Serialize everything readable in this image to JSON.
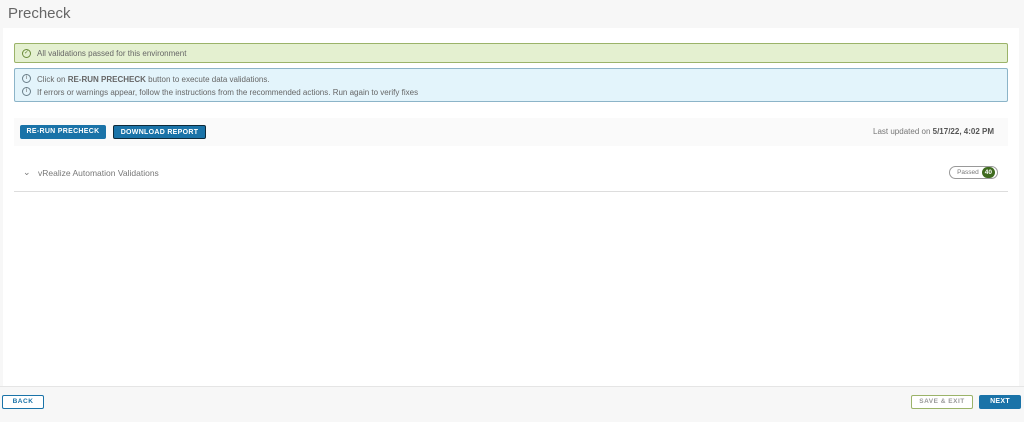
{
  "title": "Precheck",
  "alerts": {
    "success": "All validations passed for this environment",
    "info1_pre": "Click on ",
    "info1_bold": "RE-RUN PRECHECK",
    "info1_post": " button to execute data validations.",
    "info2": "If errors or warnings appear, follow the instructions from the recommended actions. Run again to verify fixes"
  },
  "toolbar": {
    "rerun": "RE-RUN PRECHECK",
    "download": "DOWNLOAD REPORT",
    "updated_label": "Last updated on ",
    "updated_value": "5/17/22, 4:02 PM"
  },
  "section": {
    "label": "vRealize Automation Validations",
    "status": "Passed",
    "count": "40"
  },
  "footer": {
    "back": "BACK",
    "save_exit": "SAVE & EXIT",
    "next": "NEXT"
  }
}
